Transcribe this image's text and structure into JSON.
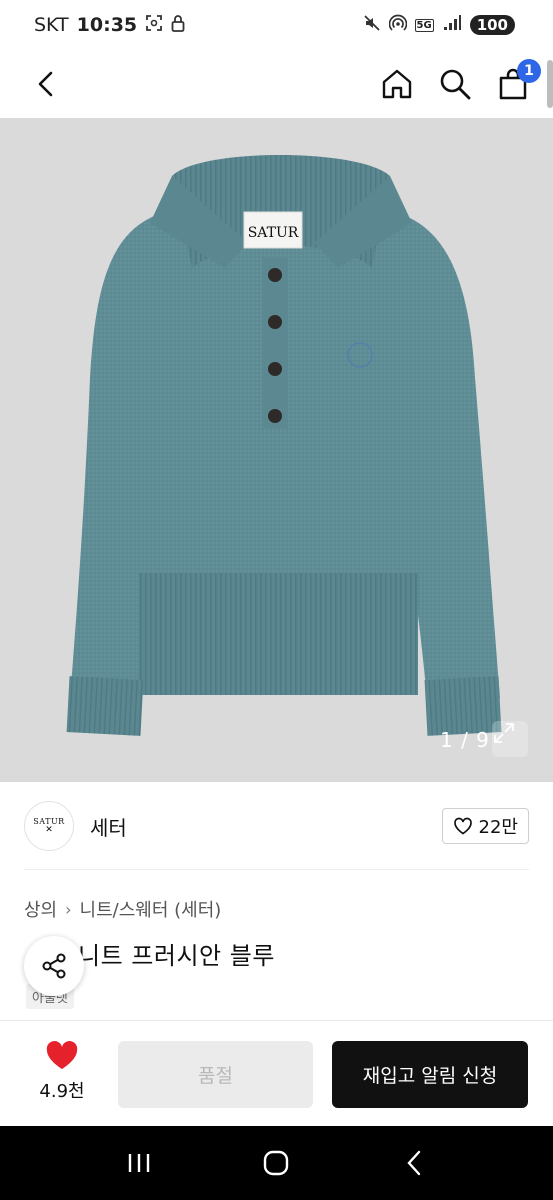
{
  "status_bar": {
    "carrier": "SKT",
    "time": "10:35",
    "network": "5G",
    "battery": "100"
  },
  "header": {
    "cart_count": "1",
    "icons": [
      "back-arrow-icon",
      "home-icon",
      "search-icon",
      "shopping-bag-icon"
    ]
  },
  "product_image": {
    "brand_label": "SATUR",
    "counter": "1 / 9",
    "garment_color": "#5f8d96"
  },
  "brand": {
    "logo_text": "SATUR",
    "logo_mark": "✕",
    "name": "세터",
    "like_count": "22만"
  },
  "breadcrumb": {
    "level1": "상의",
    "separator": "›",
    "level2": "니트/스웨터 (세터)"
  },
  "product": {
    "title": "니트 프러시안 블루",
    "tag": "아울렛"
  },
  "action_bar": {
    "wish_count": "4.9천",
    "soldout_label": "품절",
    "restock_label": "재입고 알림 신청",
    "accent_heart": "#e5222b"
  }
}
